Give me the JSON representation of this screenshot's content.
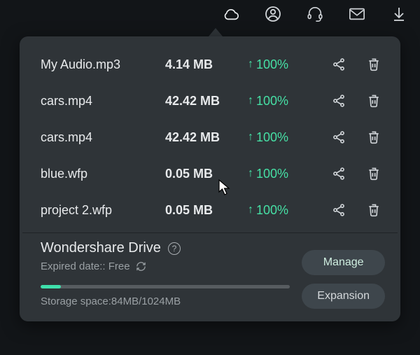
{
  "topbar": {
    "icons": [
      "cloud-icon",
      "profile-icon",
      "support-icon",
      "mail-icon",
      "download-icon"
    ]
  },
  "files": [
    {
      "name": "My Audio.mp3",
      "size": "4.14 MB",
      "progress": "100%"
    },
    {
      "name": "cars.mp4",
      "size": "42.42 MB",
      "progress": "100%"
    },
    {
      "name": "cars.mp4",
      "size": "42.42 MB",
      "progress": "100%"
    },
    {
      "name": "blue.wfp",
      "size": "0.05 MB",
      "progress": "100%"
    },
    {
      "name": "project 2.wfp",
      "size": "0.05 MB",
      "progress": "100%"
    }
  ],
  "drive": {
    "title": "Wondershare Drive",
    "expired_label": "Expired date:: Free",
    "manage_label": "Manage",
    "expansion_label": "Expansion",
    "storage_label": "Storage space:84MB/1024MB",
    "storage_used": 84,
    "storage_total": 1024
  },
  "colors": {
    "accent_green": "#46e0a5",
    "panel_bg": "#2f3438"
  }
}
